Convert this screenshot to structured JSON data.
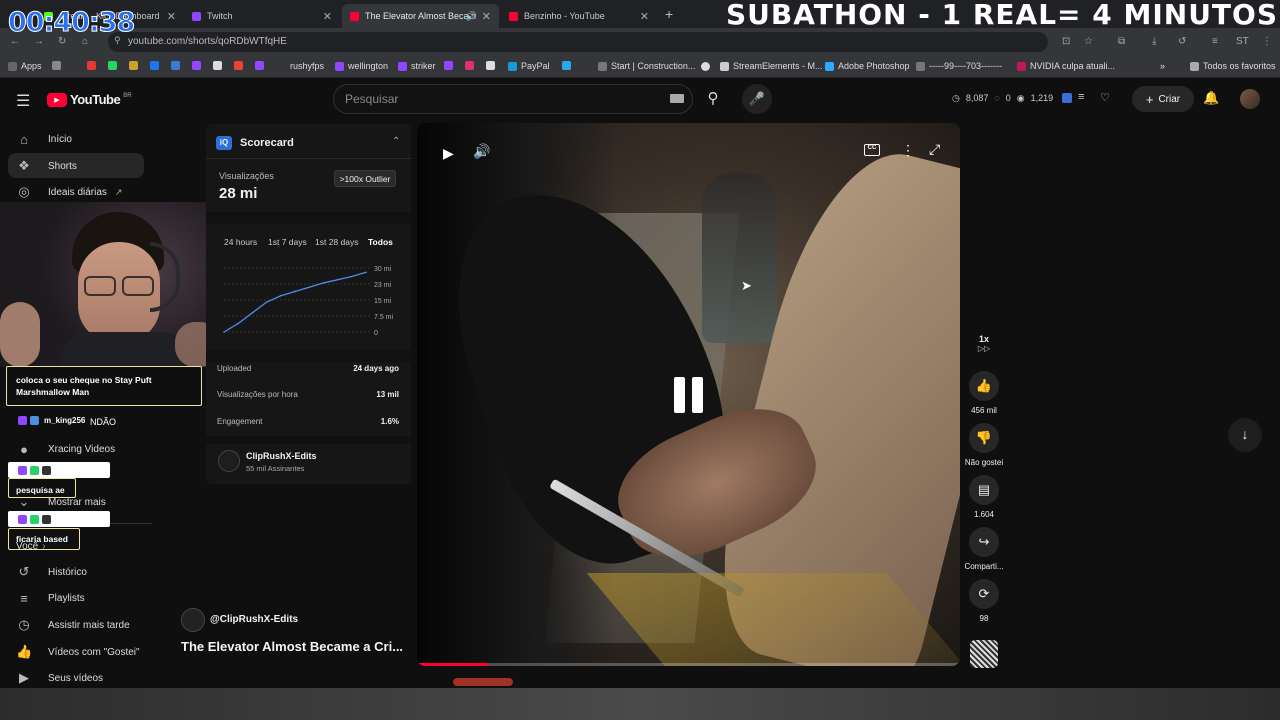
{
  "overlay": {
    "timer": "00:40:38",
    "banner": "SUBATHON - 1 REAL= 4 MINUTOS"
  },
  "tabs": [
    {
      "label": "Stream - Kick Dashboard",
      "color": "#53fc18"
    },
    {
      "label": "Twitch",
      "color": "#9146ff"
    },
    {
      "label": "The Elevator Almost Becam",
      "color": "#ff0033"
    },
    {
      "label": "Benzinho - YouTube",
      "color": "#ff0033"
    }
  ],
  "address": {
    "url": "youtube.com/shorts/qoRDbWTfqHE"
  },
  "bookmarks": [
    {
      "label": "Apps",
      "color": "#666"
    },
    {
      "label": "rushyfps",
      "color": "#9146ff"
    },
    {
      "label": "wellington",
      "color": "#9146ff"
    },
    {
      "label": "striker",
      "color": "#9146ff"
    },
    {
      "label": "PayPal",
      "color": "#179bd7"
    },
    {
      "label": "Start | Construction...",
      "color": "#777"
    },
    {
      "label": "StreamElements - M...",
      "color": "#ddd"
    },
    {
      "label": "Adobe Photoshop",
      "color": "#31a8ff"
    },
    {
      "label": "-----99----703-------",
      "color": "#777"
    },
    {
      "label": "NVIDIA culpa atuali...",
      "color": "#c2185b"
    },
    {
      "label": "Todos os favoritos",
      "color": "#aaa"
    }
  ],
  "youtube": {
    "logo": "YouTube",
    "country": "BR",
    "search_placeholder": "Pesquisar",
    "stats": {
      "a": "8,087",
      "b": "0",
      "c": "1,219"
    },
    "create_label": "Criar"
  },
  "sidebar": {
    "items": [
      {
        "label": "Início",
        "icon": "home-icon"
      },
      {
        "label": "Shorts",
        "icon": "shorts-icon"
      },
      {
        "label": "Ideais diárias",
        "icon": "ideas-icon"
      },
      {
        "label": "Xracing Videos",
        "icon": "channel-avatar"
      },
      {
        "label": "Mostrar mais",
        "icon": "chevron-down-icon"
      },
      {
        "label": "Você",
        "icon": "chevron-right-icon"
      },
      {
        "label": "Histórico",
        "icon": "history-icon"
      },
      {
        "label": "Playlists",
        "icon": "playlists-icon"
      },
      {
        "label": "Assistir mais tarde",
        "icon": "clock-icon"
      },
      {
        "label": "Vídeos com \"Gostei\"",
        "icon": "thumb-up-icon"
      },
      {
        "label": "Seus vídeos",
        "icon": "video-icon"
      }
    ]
  },
  "scorecard": {
    "title": "Scorecard",
    "views_label": "Visualizações",
    "views_value": "28 mi",
    "outlier": ">100x Outlier",
    "ranges": [
      "24 hours",
      "1st 7 days",
      "1st 28 days",
      "Todos"
    ],
    "uploaded_label": "Uploaded",
    "uploaded_value": "24 days ago",
    "vph_label": "Visualizações por hora",
    "vph_value": "13 mil",
    "eng_label": "Engagement",
    "eng_value": "1.6%",
    "channel_name": "ClipRushX-Edits",
    "channel_subs": "55 mil Assinantes"
  },
  "chart_data": {
    "type": "line",
    "y_ticks": [
      "30 mi",
      "23 mi",
      "15 mi",
      "7.5 mi",
      "0"
    ],
    "ylim": [
      0,
      30
    ],
    "x": [
      0,
      1,
      2,
      3,
      4,
      5,
      6,
      7,
      8,
      9,
      10
    ],
    "values": [
      0,
      4,
      9,
      14,
      17,
      19,
      21,
      23,
      24.5,
      26,
      28
    ],
    "color": "#4a90e2"
  },
  "video": {
    "channel": "@ClipRushX-Edits",
    "title": "The Elevator Almost Became a Cri...",
    "progress": 0.13
  },
  "actions": {
    "speed": "1x",
    "likes": "456 mil",
    "dislike": "Não gostei",
    "comments": "1.604",
    "share": "Comparti...",
    "remix": "98"
  },
  "chat": [
    {
      "user": "",
      "text": "coloca o seu cheque no Stay Puft Marshmallow Man"
    },
    {
      "user": "m_king256",
      "text": "NDÃO"
    },
    {
      "user": "",
      "text": "pesquisa ae"
    },
    {
      "user": "",
      "text": "ficaria based"
    }
  ]
}
